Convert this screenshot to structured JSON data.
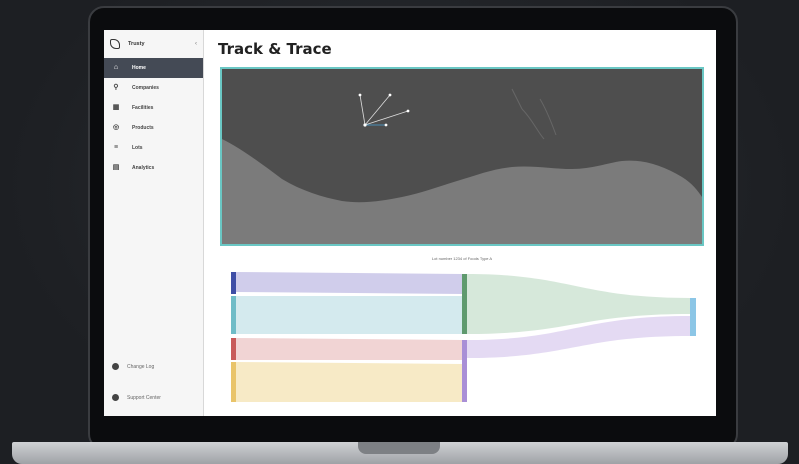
{
  "app": {
    "brand": "Trusty",
    "page_title": "Track & Trace"
  },
  "sidebar": {
    "items": [
      {
        "label": "Home",
        "icon": "home-icon",
        "active": true
      },
      {
        "label": "Companies",
        "icon": "companies-icon",
        "active": false
      },
      {
        "label": "Facilities",
        "icon": "facilities-icon",
        "active": false
      },
      {
        "label": "Products",
        "icon": "products-icon",
        "active": false
      },
      {
        "label": "Lots",
        "icon": "lots-icon",
        "active": false
      },
      {
        "label": "Analytics",
        "icon": "analytics-icon",
        "active": false
      }
    ],
    "footer": [
      {
        "label": "Change Log",
        "icon": "changelog-icon"
      },
      {
        "label": "Support Center",
        "icon": "support-icon"
      }
    ]
  },
  "sankey": {
    "title": "Lot number 1234 of Foods Type A",
    "colors": {
      "purple_dark": "#3f4ea6",
      "purple_light": "#c8c4e8",
      "teal": "#6fbcc7",
      "teal_light": "#cfe8ec",
      "red": "#c85a5a",
      "red_light": "#f0cfcf",
      "yellow": "#e9c46a",
      "yellow_light": "#f6e8c0",
      "green": "#5f9a6e",
      "green_light": "#d2e6d6",
      "lavender": "#a98fd6",
      "lavender_light": "#e1d6f2",
      "blue": "#8cc6e6"
    }
  },
  "map": {
    "accent": "#6ac7c4",
    "land": "#505050",
    "water": "#7a7a7a",
    "route_color": "#4aa3d8"
  }
}
